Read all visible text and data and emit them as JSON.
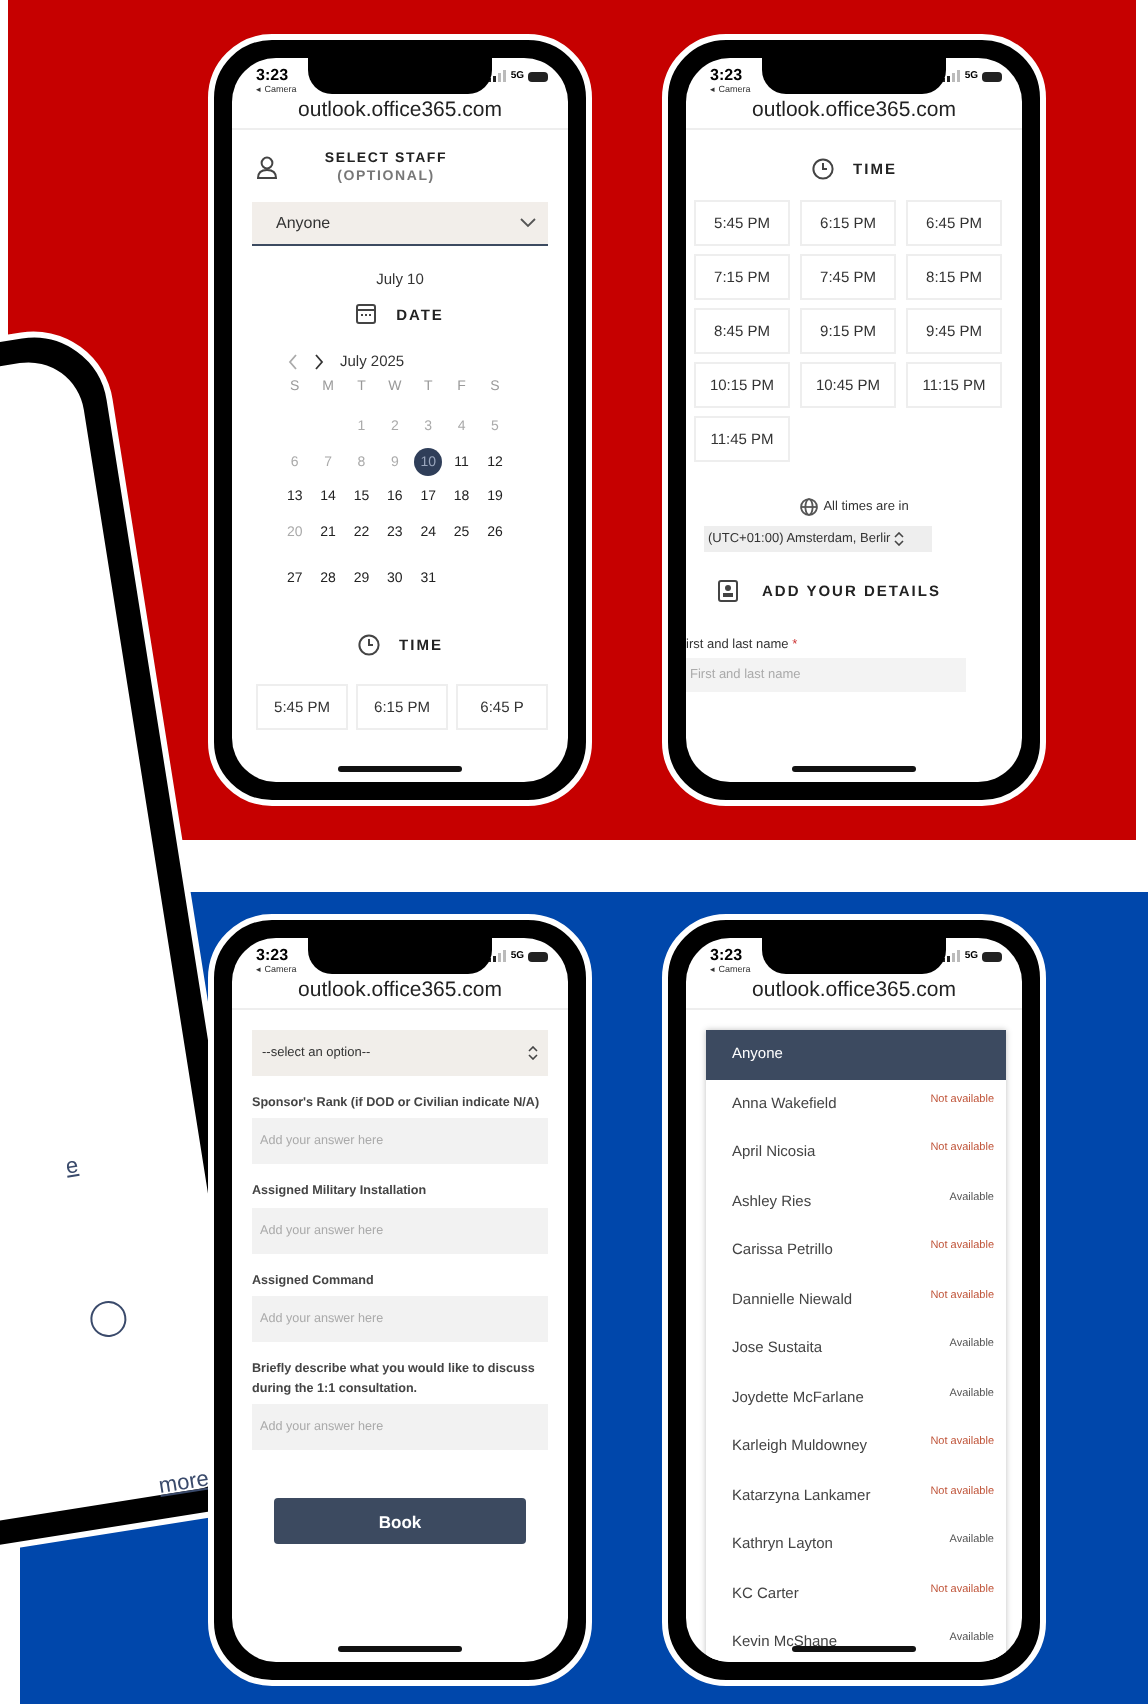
{
  "side_phone": {
    "texts": [
      "e"
    ],
    "link": "more"
  },
  "phones": [
    {
      "kind": "calendar",
      "status": {
        "time": "3:23",
        "back": "◂ Camera",
        "network": "5G"
      },
      "url": "outlook.office365.com",
      "staff": {
        "title": "SELECT STAFF",
        "note": "(OPTIONAL)",
        "value": "Anyone"
      },
      "picked_date": "July 10",
      "date_heading": "DATE",
      "month": "July 2025",
      "weekdays": [
        "S",
        "M",
        "T",
        "W",
        "T",
        "F",
        "S"
      ],
      "weeks": [
        [
          {
            "label": "1",
            "disabled": true,
            "selected": false
          },
          {
            "label": "2",
            "disabled": true,
            "selected": false
          },
          {
            "label": "3",
            "disabled": true,
            "selected": false
          },
          {
            "label": "4",
            "disabled": true,
            "selected": false
          },
          {
            "label": "5",
            "disabled": true,
            "selected": false
          }
        ],
        [
          {
            "label": "6",
            "disabled": true,
            "selected": false
          },
          {
            "label": "7",
            "disabled": true,
            "selected": false
          },
          {
            "label": "8",
            "disabled": true,
            "selected": false
          },
          {
            "label": "9",
            "disabled": true,
            "selected": false
          },
          {
            "label": "10",
            "disabled": false,
            "selected": true
          },
          {
            "label": "11",
            "disabled": false,
            "selected": false
          },
          {
            "label": "12",
            "disabled": false,
            "selected": false
          }
        ],
        [
          {
            "label": "13",
            "disabled": false,
            "selected": false
          },
          {
            "label": "14",
            "disabled": false,
            "selected": false
          },
          {
            "label": "15",
            "disabled": false,
            "selected": false
          },
          {
            "label": "16",
            "disabled": false,
            "selected": false
          },
          {
            "label": "17",
            "disabled": false,
            "selected": false
          },
          {
            "label": "18",
            "disabled": false,
            "selected": false
          },
          {
            "label": "19",
            "disabled": false,
            "selected": false
          }
        ],
        [
          {
            "label": "20",
            "disabled": true,
            "selected": false
          },
          {
            "label": "21",
            "disabled": false,
            "selected": false
          },
          {
            "label": "22",
            "disabled": false,
            "selected": false
          },
          {
            "label": "23",
            "disabled": false,
            "selected": false
          },
          {
            "label": "24",
            "disabled": false,
            "selected": false
          },
          {
            "label": "25",
            "disabled": false,
            "selected": false
          },
          {
            "label": "26",
            "disabled": false,
            "selected": false
          }
        ],
        [
          {
            "label": "27",
            "disabled": false,
            "selected": false
          },
          {
            "label": "28",
            "disabled": false,
            "selected": false
          },
          {
            "label": "29",
            "disabled": false,
            "selected": false
          },
          {
            "label": "30",
            "disabled": false,
            "selected": false
          },
          {
            "label": "31",
            "disabled": false,
            "selected": false
          }
        ]
      ],
      "time_heading": "TIME",
      "slots": [
        "5:45 PM",
        "6:15 PM",
        "6:45 P"
      ]
    },
    {
      "kind": "times",
      "status": {
        "time": "3:23",
        "back": "◂ Camera",
        "network": "5G"
      },
      "url": "outlook.office365.com",
      "time_heading": "TIME",
      "slots": [
        "5:45 PM",
        "6:15 PM",
        "6:45 PM",
        "7:15 PM",
        "7:45 PM",
        "8:15 PM",
        "8:45 PM",
        "9:15 PM",
        "9:45 PM",
        "10:15 PM",
        "10:45 PM",
        "11:15 PM",
        "11:45 PM"
      ],
      "tz_note": "All times are in",
      "tz_value": "(UTC+01:00) Amsterdam, Berlir",
      "details_heading": "ADD YOUR DETAILS",
      "name_label": "irst and last name",
      "required_mark": "*",
      "name_placeholder": "First and last name"
    },
    {
      "kind": "form",
      "status": {
        "time": "3:23",
        "back": "◂ Camera",
        "network": "5G"
      },
      "url": "outlook.office365.com",
      "select_value": "--select an option--",
      "fields": [
        {
          "label": "Sponsor's Rank (if DOD or Civilian indicate N/A)",
          "placeholder": "Add your answer here"
        },
        {
          "label": "Assigned Military Installation",
          "placeholder": "Add your answer here"
        },
        {
          "label": "Assigned Command",
          "placeholder": "Add your answer here"
        },
        {
          "label": "Briefly describe what you would like to discuss during the 1:1 consultation.",
          "placeholder": "Add your answer here"
        }
      ],
      "button": "Book"
    },
    {
      "kind": "staff_list",
      "status": {
        "time": "3:23",
        "back": "◂ Camera",
        "network": "5G"
      },
      "url": "outlook.office365.com",
      "options": [
        {
          "name": "Anyone",
          "selected": true
        },
        {
          "name": "Anna Wakefield",
          "status": "Not available",
          "available": false,
          "selected": false
        },
        {
          "name": "April Nicosia",
          "status": "Not available",
          "available": false,
          "selected": false
        },
        {
          "name": "Ashley Ries",
          "status": "Available",
          "available": true,
          "selected": false
        },
        {
          "name": "Carissa Petrillo",
          "status": "Not available",
          "available": false,
          "selected": false
        },
        {
          "name": "Dannielle Niewald",
          "status": "Not available",
          "available": false,
          "selected": false
        },
        {
          "name": "Jose Sustaita",
          "status": "Available",
          "available": true,
          "selected": false
        },
        {
          "name": "Joydette McFarlane",
          "status": "Available",
          "available": true,
          "selected": false
        },
        {
          "name": "Karleigh Muldowney",
          "status": "Not available",
          "available": false,
          "selected": false
        },
        {
          "name": "Katarzyna Lankamer",
          "status": "Not available",
          "available": false,
          "selected": false
        },
        {
          "name": "Kathryn Layton",
          "status": "Available",
          "available": true,
          "selected": false
        },
        {
          "name": "KC Carter",
          "status": "Not available",
          "available": false,
          "selected": false
        },
        {
          "name": "Kevin McShane",
          "status": "Available",
          "available": true,
          "selected": false
        }
      ]
    }
  ]
}
